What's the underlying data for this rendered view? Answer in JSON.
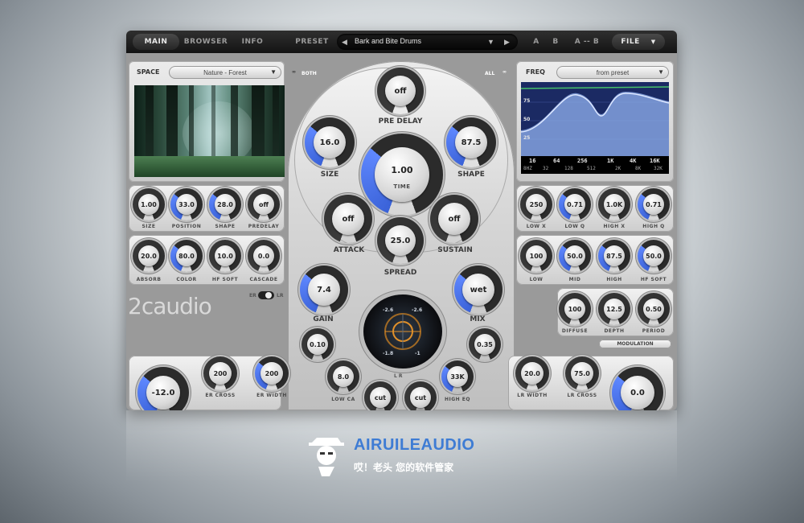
{
  "tabs": [
    "MAIN",
    "BROWSER",
    "INFO"
  ],
  "preset_label": "PRESET",
  "preset_name": "Bark and Bite Drums",
  "ab": {
    "a": "A",
    "b": "B",
    "ab": "A -- B"
  },
  "file_label": "FILE",
  "space": {
    "label": "SPACE",
    "value": "Nature - Forest"
  },
  "freq": {
    "label": "FREQ",
    "value": "from preset",
    "y_labels": [
      "75",
      "50",
      "25"
    ],
    "x_top": [
      "16",
      "64",
      "256",
      "1K",
      "4K",
      "16K"
    ],
    "x_bottom": [
      "8HZ",
      "32",
      "128",
      "512",
      "2K",
      "8K",
      "32K"
    ]
  },
  "both_label": "BOTH",
  "all_label": "ALL",
  "center": {
    "predelay": {
      "value": "off",
      "label": "PRE DELAY"
    },
    "size": {
      "value": "16.0",
      "label": "SIZE"
    },
    "time": {
      "value": "1.00",
      "unit": "TIME"
    },
    "shape": {
      "value": "87.5",
      "label": "SHAPE"
    },
    "attack": {
      "value": "off",
      "label": "ATTACK"
    },
    "sustain": {
      "value": "off",
      "label": "SUSTAIN"
    },
    "spread": {
      "value": "25.0",
      "label": "SPREAD"
    },
    "gain": {
      "value": "7.4",
      "label": "GAIN"
    },
    "mix": {
      "value": "wet",
      "label": "MIX"
    },
    "vu": {
      "l_top": "-2.6",
      "r_top": "-2.6",
      "l_bot": "-1.8",
      "r_bot": "-1",
      "label": "L R"
    },
    "k1": {
      "value": "0.10"
    },
    "k2": {
      "value": "0.35"
    },
    "lowcut": {
      "value": "8.0",
      "label": "LOW CA"
    },
    "higheq": {
      "value": "33K",
      "label": "HIGH EQ"
    },
    "cut1": {
      "value": "cut"
    },
    "cut2": {
      "value": "cut"
    }
  },
  "left_knobs_row1": [
    {
      "value": "1.00",
      "label": "SIZE"
    },
    {
      "value": "33.0",
      "label": "POSITION"
    },
    {
      "value": "28.0",
      "label": "SHAPE"
    },
    {
      "value": "off",
      "label": "PREDELAY"
    }
  ],
  "left_knobs_row2": [
    {
      "value": "20.0",
      "label": "ABSORB"
    },
    {
      "value": "80.0",
      "label": "COLOR"
    },
    {
      "value": "10.0",
      "label": "HF SOFT"
    },
    {
      "value": "0.0",
      "label": "CASCADE"
    }
  ],
  "er_toggle": {
    "left": "ER",
    "right": "LR"
  },
  "left_bottom": [
    {
      "value": "-12.0",
      "label": ""
    },
    {
      "value": "200",
      "label": "ER CROSS"
    },
    {
      "value": "200",
      "label": "ER WIDTH"
    }
  ],
  "logo": "2caudio",
  "right_knobs_row1": [
    {
      "value": "250",
      "label": "LOW X"
    },
    {
      "value": "0.71",
      "label": "LOW Q"
    },
    {
      "value": "1.0K",
      "label": "HIGH X"
    },
    {
      "value": "0.71",
      "label": "HIGH Q"
    }
  ],
  "right_knobs_row2": [
    {
      "value": "100",
      "label": "LOW"
    },
    {
      "value": "50.0",
      "label": "MID"
    },
    {
      "value": "87.5",
      "label": "HIGH"
    },
    {
      "value": "50.0",
      "label": "HF SOFT"
    }
  ],
  "right_knobs_row3": [
    {
      "value": "100",
      "label": "DIFFUSE"
    },
    {
      "value": "12.5",
      "label": "DEPTH"
    },
    {
      "value": "0.50",
      "label": "PERIOD"
    }
  ],
  "modulation_label": "MODULATION",
  "right_bottom": [
    {
      "value": "20.0",
      "label": "LR WIDTH"
    },
    {
      "value": "75.0",
      "label": "LR CROSS"
    },
    {
      "value": "0.0",
      "label": ""
    }
  ],
  "watermark": {
    "title": "AIRUILEAUDIO",
    "subtitle": "哎！老头 您的软件管家"
  },
  "colors": {
    "accent": "#3a62d8",
    "knob_ring": "#2c2c2c"
  }
}
